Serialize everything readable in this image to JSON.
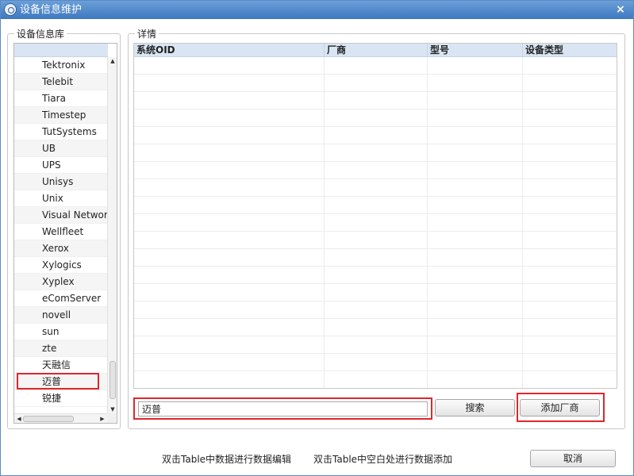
{
  "window": {
    "title": "设备信息维护",
    "close_label": "×"
  },
  "library": {
    "legend": "设备信息库",
    "items": [
      "Tektronix",
      "Telebit",
      "Tiara",
      "Timestep",
      "TutSystems",
      "UB",
      "UPS",
      "Unisys",
      "Unix",
      "Visual Networl",
      "Wellfleet",
      "Xerox",
      "Xylogics",
      "Xyplex",
      "eComServer",
      "novell",
      "sun",
      "zte",
      "天融信",
      "迈普",
      "锐捷"
    ],
    "selected_index": 19
  },
  "details": {
    "legend": "详情",
    "columns": [
      "系统OID",
      "厂商",
      "型号",
      "设备类型"
    ],
    "row_count": 19
  },
  "search": {
    "value": "迈普",
    "button_label": "搜索"
  },
  "add_vendor_label": "添加厂商",
  "hints": {
    "edit": "双击Table中数据进行数据编辑",
    "add": "双击Table中空白处进行数据添加"
  },
  "cancel_label": "取消"
}
